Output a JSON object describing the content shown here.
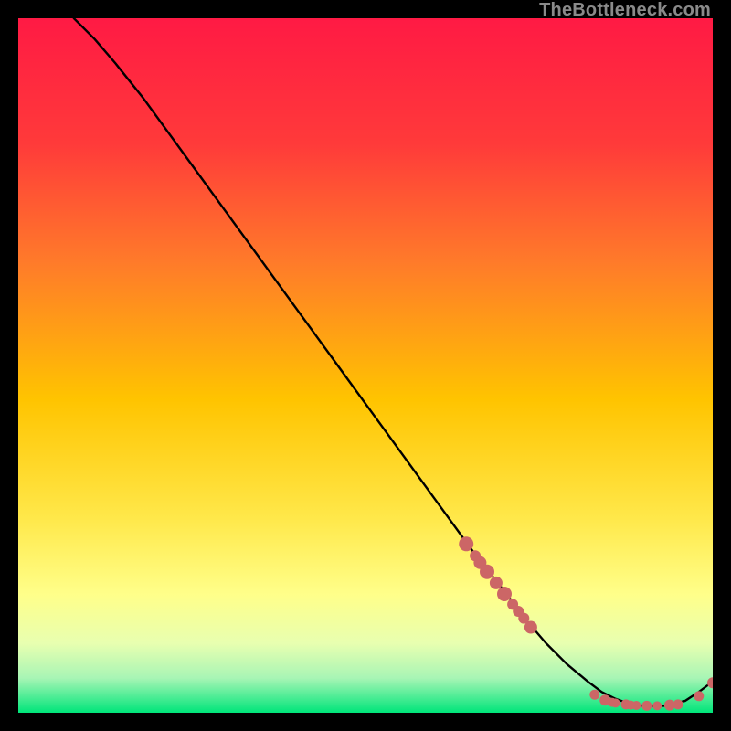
{
  "watermark": "TheBottleneck.com",
  "chart_data": {
    "type": "line",
    "title": "",
    "xlabel": "",
    "ylabel": "",
    "xlim": [
      0,
      100
    ],
    "ylim": [
      0,
      100
    ],
    "background_gradient": {
      "top": "#ff1a44",
      "mid1": "#ff6a2a",
      "mid2": "#ffd400",
      "mid3": "#ffff66",
      "lower": "#ccff99",
      "bottom": "#00e57a"
    },
    "series": [
      {
        "name": "curve",
        "color": "#000000",
        "x": [
          8,
          11,
          14,
          18,
          22,
          26,
          30,
          34,
          38,
          42,
          46,
          50,
          54,
          58,
          62,
          66,
          70,
          73,
          76,
          79,
          82,
          84,
          86,
          88,
          90,
          93,
          96,
          98,
          100
        ],
        "y": [
          100,
          97,
          93.5,
          88.5,
          83,
          77.5,
          72,
          66.5,
          61,
          55.5,
          50,
          44.5,
          39,
          33.5,
          28,
          22.5,
          17.5,
          13.5,
          10,
          7,
          4.5,
          3,
          2,
          1.3,
          1,
          1,
          1.7,
          3,
          4.5
        ]
      }
    ],
    "markers": [
      {
        "name": "data-points",
        "color": "#cc6666",
        "x": [
          64.5,
          65.8,
          66.5,
          67.5,
          68.8,
          70.0,
          71.2,
          72.0,
          72.8,
          73.8,
          83.0,
          84.5,
          85.5,
          86.0,
          87.5,
          88.2,
          89.0,
          90.5,
          92.0,
          93.8,
          95.0,
          98.0,
          100.0
        ],
        "y": [
          24.3,
          22.6,
          21.6,
          20.3,
          18.7,
          17.1,
          15.6,
          14.6,
          13.6,
          12.3,
          2.6,
          1.8,
          1.5,
          1.4,
          1.2,
          1.1,
          1.05,
          1.0,
          1.0,
          1.1,
          1.2,
          2.4,
          4.3
        ],
        "r": [
          8,
          6,
          7,
          8,
          7,
          8,
          6,
          6,
          6,
          7,
          5.5,
          6,
          5,
          5,
          5.5,
          5,
          5,
          5.5,
          5,
          6,
          5.5,
          5.5,
          6
        ]
      }
    ]
  }
}
